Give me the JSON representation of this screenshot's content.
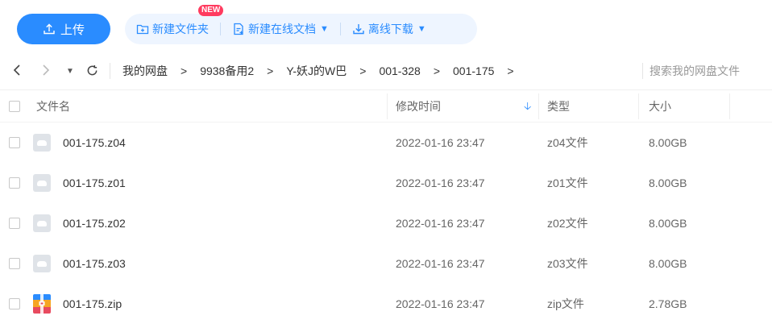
{
  "toolbar": {
    "upload_label": "上传",
    "new_folder_label": "新建文件夹",
    "new_online_doc_label": "新建在线文档",
    "new_badge": "NEW",
    "offline_download_label": "离线下载"
  },
  "nav": {
    "breadcrumbs": [
      "我的网盘",
      "9938备用2",
      "Y-妖J的W巴",
      "001-328",
      "001-175"
    ],
    "crumb_separator": ">",
    "search_placeholder": "搜索我的网盘文件"
  },
  "table": {
    "headers": {
      "name": "文件名",
      "modified": "修改时间",
      "type": "类型",
      "size": "大小"
    },
    "sort_column": "modified",
    "sort_direction": "desc",
    "rows": [
      {
        "name": "001-175.z04",
        "modified": "2022-01-16 23:47",
        "type": "z04文件",
        "size": "8.00GB",
        "icon": "file-icon"
      },
      {
        "name": "001-175.z01",
        "modified": "2022-01-16 23:47",
        "type": "z01文件",
        "size": "8.00GB",
        "icon": "file-icon"
      },
      {
        "name": "001-175.z02",
        "modified": "2022-01-16 23:47",
        "type": "z02文件",
        "size": "8.00GB",
        "icon": "file-icon"
      },
      {
        "name": "001-175.z03",
        "modified": "2022-01-16 23:47",
        "type": "z03文件",
        "size": "8.00GB",
        "icon": "file-icon"
      },
      {
        "name": "001-175.zip",
        "modified": "2022-01-16 23:47",
        "type": "zip文件",
        "size": "2.78GB",
        "icon": "zip-archive-icon"
      }
    ]
  },
  "colors": {
    "accent": "#2a8cff",
    "badge": "#ff3b5f",
    "action_bg": "#eef5ff"
  }
}
